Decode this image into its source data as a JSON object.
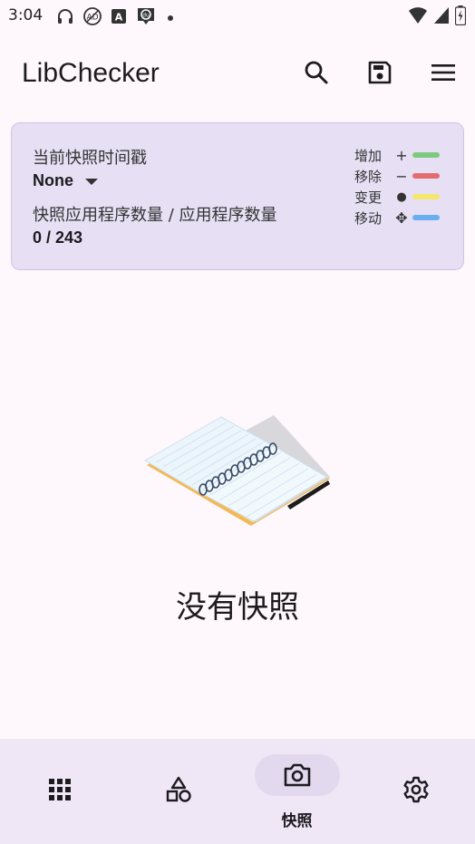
{
  "status_bar": {
    "time": "3:04",
    "left_icons": [
      "headset-icon",
      "adblock-icon",
      "app-a-icon",
      "du-icon",
      "dot-icon"
    ],
    "right_icons": [
      "wifi-icon",
      "signal-icon",
      "battery-charging-icon"
    ]
  },
  "app_bar": {
    "title": "LibChecker",
    "actions": [
      "search-icon",
      "save-icon",
      "menu-icon"
    ]
  },
  "card": {
    "timestamp_label": "当前快照时间戳",
    "timestamp_value": "None",
    "count_label": "快照应用程序数量 / 应用程序数量",
    "count_value": "0 / 243",
    "legend": [
      {
        "label": "增加",
        "symbol": "+",
        "color": "#7dca7f"
      },
      {
        "label": "移除",
        "symbol": "−",
        "color": "#e56b6f"
      },
      {
        "label": "变更",
        "symbol": "●",
        "color": "#f4e76e"
      },
      {
        "label": "移动",
        "symbol": "✥",
        "color": "#6aaef0"
      }
    ]
  },
  "empty_state": {
    "text": "没有快照",
    "illustration": "notebook-icon"
  },
  "bottom_nav": {
    "items": [
      {
        "icon": "apps-grid-icon",
        "label": ""
      },
      {
        "icon": "shapes-icon",
        "label": ""
      },
      {
        "icon": "camera-icon",
        "label": "快照",
        "active": true
      },
      {
        "icon": "settings-gear-icon",
        "label": ""
      }
    ]
  },
  "colors": {
    "background": "#fef7fc",
    "card": "#e7e0f5",
    "nav": "#efe7f6",
    "nav_active_pill": "#e2d9ef"
  }
}
